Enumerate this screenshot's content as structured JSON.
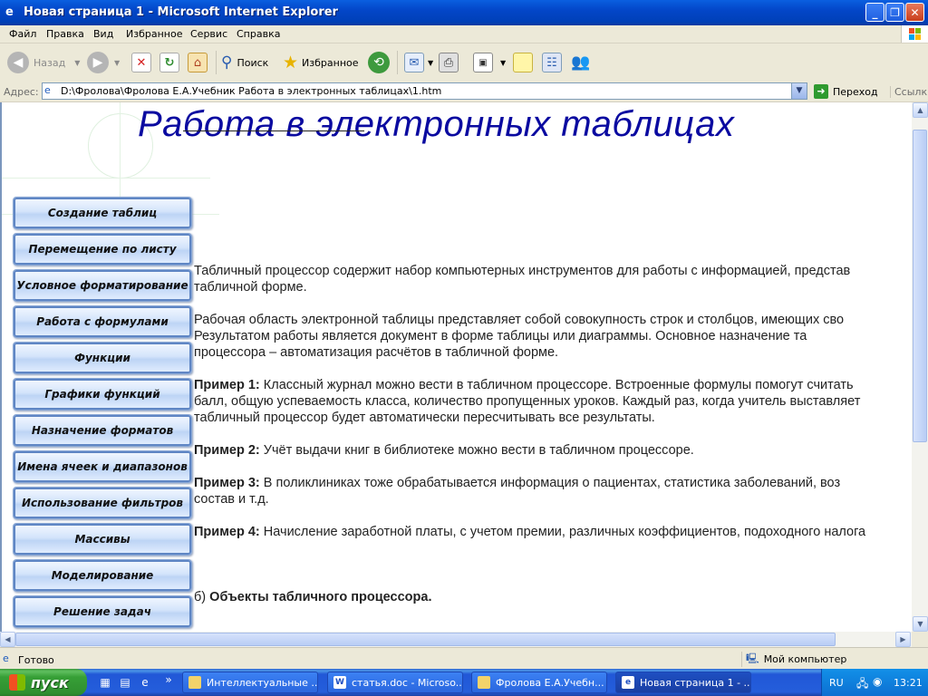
{
  "window": {
    "title": "Новая страница 1 - Microsoft Internet Explorer",
    "buttons": {
      "minimize": "_",
      "maximize": "❐",
      "close": "✕"
    }
  },
  "menu": [
    "Файл",
    "Правка",
    "Вид",
    "Избранное",
    "Сервис",
    "Справка"
  ],
  "toolbar": {
    "back_label": "Назад",
    "search_label": "Поиск",
    "favorites_label": "Избранное"
  },
  "address": {
    "label": "Адрес:",
    "value": "D:\\Фролова\\Фролова Е.А.Учебник Работа в электронных таблицах\\1.htm",
    "go_label": "Переход",
    "links_label": "Ссылки"
  },
  "page": {
    "title": "Работа в электронных таблицах",
    "nav": [
      "Создание таблиц",
      "Перемещение по листу",
      "Условное форматирование",
      "Работа с формулами",
      "Функции",
      "Графики функций",
      "Назначение форматов",
      "Имена ячеек и диапазонов",
      "Использование фильтров",
      "Массивы",
      "Моделирование",
      "Решение задач"
    ],
    "p1_line1": "Табличный процессор содержит набор компьютерных инструментов для работы с информацией, представ",
    "p1_line2": "табличной форме.",
    "p2_line1": "Рабочая область электронной таблицы представляет собой совокупность строк и столбцов, имеющих сво",
    "p2_line2": "Результатом работы является документ в форме  таблицы или диаграммы. Основное назначение та",
    "p2_line3": "процессора – автоматизация расчётов в табличной форме.",
    "ex1_label": "Пример 1:",
    "ex1_line1": " Классный журнал можно  вести в табличном процессоре. Встроенные формулы помогут считать",
    "ex1_line2": "балл, общую успеваемость класса, количество пропущенных уроков. Каждый раз, когда учитель выставляет",
    "ex1_line3": "табличный процессор будет автоматически пересчитывать все результаты.",
    "ex2_label": "Пример 2:",
    "ex2_text": " Учёт выдачи книг в библиотеке можно вести в табличном процессоре.",
    "ex3_label": "Пример 3:",
    "ex3_line1": " В поликлиниках тоже обрабатывается информация о пациентах, статистика заболеваний, воз",
    "ex3_line2": "состав и т.д.",
    "ex4_label": "Пример 4:",
    "ex4_text": " Начисление заработной платы, с учетом премии, различных коэффициентов, подоходного налога",
    "section_prefix": "б) ",
    "section_title": "Объекты табличного процессора."
  },
  "status": {
    "text": "Готово",
    "zone": "Мой компьютер"
  },
  "taskbar": {
    "start": "пуск",
    "quick_more": "»",
    "tasks": [
      "Интеллектуальные ...",
      "статья.doc - Microso...",
      "Фролова Е.А.Учебн...",
      "Новая страница 1 - ..."
    ],
    "lang": "RU",
    "time": "13:21"
  }
}
